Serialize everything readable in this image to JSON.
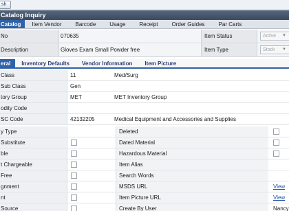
{
  "toolbar": {
    "refresh_label": "sh"
  },
  "window": {
    "title": "Catalog Inquiry"
  },
  "tabs": [
    {
      "label": "Catalog",
      "active": true
    },
    {
      "label": "Item Vendor"
    },
    {
      "label": "Barcode"
    },
    {
      "label": "Usage"
    },
    {
      "label": "Receipt"
    },
    {
      "label": "Order Guides"
    },
    {
      "label": "Par Carts"
    }
  ],
  "header": {
    "item_no_label": "No",
    "item_no_value": "070635",
    "description_label": "Description",
    "description_value": "Gloves Exam Small Powder free",
    "status_label": "Item Status",
    "status_value": "Active",
    "type_label": "Item Type",
    "type_value": "Stock"
  },
  "subtabs": [
    {
      "label": "eral",
      "active": true
    },
    {
      "label": "Inventory Defaults"
    },
    {
      "label": "Vendor Information"
    },
    {
      "label": "Item Picture"
    }
  ],
  "details": {
    "class_label": "Class",
    "class_value": "11",
    "class_desc": "Med/Surg",
    "subclass_label": "Sub Class",
    "subclass_value": "Gen",
    "group_label": "tory Group",
    "group_value": "MET",
    "group_desc": "MET Inventory Group",
    "commodity_label": "odity Code",
    "unspsc_label": "SC Code",
    "unspsc_value": "42132205",
    "unspsc_desc": "Medical Equipment and Accessories and Supplies",
    "type_label": "y Type",
    "substitute_label": "Substitute",
    "ble_label": "ble",
    "chargeable_label": "t Chargeable",
    "free_label": "Free",
    "gnment_label": "gnment",
    "nt_label": "nt",
    "source_label": "Source",
    "deleted_label": "Deleted",
    "dated_label": "Dated Material",
    "hazardous_label": "Hazardous Material",
    "alias_label": "Item Alias",
    "search_label": "Search Words",
    "msds_label": "MSDS URL",
    "msds_link": "View",
    "picture_label": "Item Picture URL",
    "picture_link": "View",
    "created_label": "Create By User",
    "created_value": "Nancy"
  }
}
